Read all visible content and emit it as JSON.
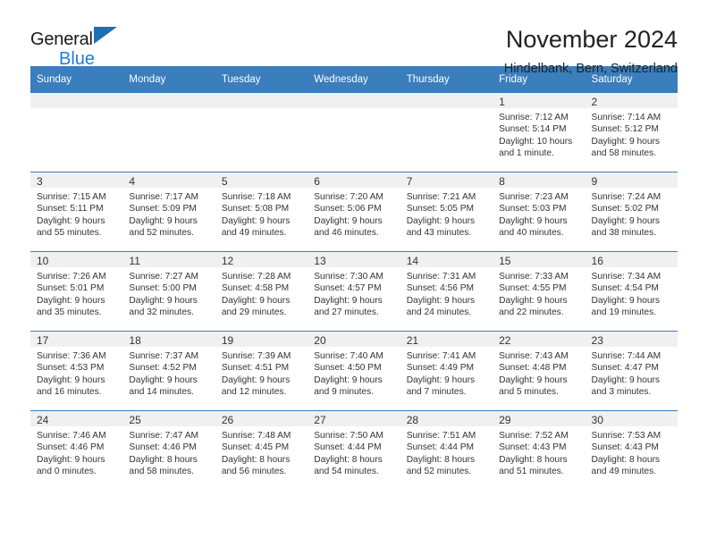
{
  "brand": {
    "line1": "General",
    "line2": "Blue",
    "triangle_color": "#1f6fb5",
    "blue_text_color": "#1f7fd0"
  },
  "header": {
    "title": "November 2024",
    "subtitle": "Hindelbank, Bern, Switzerland"
  },
  "theme": {
    "header_bar": "#3a7ebe",
    "daynum_band": "#f0f0f0",
    "cell_border": "#3a7ebe",
    "text": "#333333"
  },
  "calendar": {
    "weekday_headers": [
      "Sunday",
      "Monday",
      "Tuesday",
      "Wednesday",
      "Thursday",
      "Friday",
      "Saturday"
    ],
    "labels": {
      "sunrise": "Sunrise:",
      "sunset": "Sunset:",
      "daylight": "Daylight:"
    },
    "weeks": [
      [
        {
          "day": "",
          "empty": true,
          "sunrise": "",
          "sunset": "",
          "daylight_1": "",
          "daylight_2": ""
        },
        {
          "day": "",
          "empty": true,
          "sunrise": "",
          "sunset": "",
          "daylight_1": "",
          "daylight_2": ""
        },
        {
          "day": "",
          "empty": true,
          "sunrise": "",
          "sunset": "",
          "daylight_1": "",
          "daylight_2": ""
        },
        {
          "day": "",
          "empty": true,
          "sunrise": "",
          "sunset": "",
          "daylight_1": "",
          "daylight_2": ""
        },
        {
          "day": "",
          "empty": true,
          "sunrise": "",
          "sunset": "",
          "daylight_1": "",
          "daylight_2": ""
        },
        {
          "day": "1",
          "empty": false,
          "sunrise": "Sunrise: 7:12 AM",
          "sunset": "Sunset: 5:14 PM",
          "daylight_1": "Daylight: 10 hours",
          "daylight_2": "and 1 minute."
        },
        {
          "day": "2",
          "empty": false,
          "sunrise": "Sunrise: 7:14 AM",
          "sunset": "Sunset: 5:12 PM",
          "daylight_1": "Daylight: 9 hours",
          "daylight_2": "and 58 minutes."
        }
      ],
      [
        {
          "day": "3",
          "empty": false,
          "sunrise": "Sunrise: 7:15 AM",
          "sunset": "Sunset: 5:11 PM",
          "daylight_1": "Daylight: 9 hours",
          "daylight_2": "and 55 minutes."
        },
        {
          "day": "4",
          "empty": false,
          "sunrise": "Sunrise: 7:17 AM",
          "sunset": "Sunset: 5:09 PM",
          "daylight_1": "Daylight: 9 hours",
          "daylight_2": "and 52 minutes."
        },
        {
          "day": "5",
          "empty": false,
          "sunrise": "Sunrise: 7:18 AM",
          "sunset": "Sunset: 5:08 PM",
          "daylight_1": "Daylight: 9 hours",
          "daylight_2": "and 49 minutes."
        },
        {
          "day": "6",
          "empty": false,
          "sunrise": "Sunrise: 7:20 AM",
          "sunset": "Sunset: 5:06 PM",
          "daylight_1": "Daylight: 9 hours",
          "daylight_2": "and 46 minutes."
        },
        {
          "day": "7",
          "empty": false,
          "sunrise": "Sunrise: 7:21 AM",
          "sunset": "Sunset: 5:05 PM",
          "daylight_1": "Daylight: 9 hours",
          "daylight_2": "and 43 minutes."
        },
        {
          "day": "8",
          "empty": false,
          "sunrise": "Sunrise: 7:23 AM",
          "sunset": "Sunset: 5:03 PM",
          "daylight_1": "Daylight: 9 hours",
          "daylight_2": "and 40 minutes."
        },
        {
          "day": "9",
          "empty": false,
          "sunrise": "Sunrise: 7:24 AM",
          "sunset": "Sunset: 5:02 PM",
          "daylight_1": "Daylight: 9 hours",
          "daylight_2": "and 38 minutes."
        }
      ],
      [
        {
          "day": "10",
          "empty": false,
          "sunrise": "Sunrise: 7:26 AM",
          "sunset": "Sunset: 5:01 PM",
          "daylight_1": "Daylight: 9 hours",
          "daylight_2": "and 35 minutes."
        },
        {
          "day": "11",
          "empty": false,
          "sunrise": "Sunrise: 7:27 AM",
          "sunset": "Sunset: 5:00 PM",
          "daylight_1": "Daylight: 9 hours",
          "daylight_2": "and 32 minutes."
        },
        {
          "day": "12",
          "empty": false,
          "sunrise": "Sunrise: 7:28 AM",
          "sunset": "Sunset: 4:58 PM",
          "daylight_1": "Daylight: 9 hours",
          "daylight_2": "and 29 minutes."
        },
        {
          "day": "13",
          "empty": false,
          "sunrise": "Sunrise: 7:30 AM",
          "sunset": "Sunset: 4:57 PM",
          "daylight_1": "Daylight: 9 hours",
          "daylight_2": "and 27 minutes."
        },
        {
          "day": "14",
          "empty": false,
          "sunrise": "Sunrise: 7:31 AM",
          "sunset": "Sunset: 4:56 PM",
          "daylight_1": "Daylight: 9 hours",
          "daylight_2": "and 24 minutes."
        },
        {
          "day": "15",
          "empty": false,
          "sunrise": "Sunrise: 7:33 AM",
          "sunset": "Sunset: 4:55 PM",
          "daylight_1": "Daylight: 9 hours",
          "daylight_2": "and 22 minutes."
        },
        {
          "day": "16",
          "empty": false,
          "sunrise": "Sunrise: 7:34 AM",
          "sunset": "Sunset: 4:54 PM",
          "daylight_1": "Daylight: 9 hours",
          "daylight_2": "and 19 minutes."
        }
      ],
      [
        {
          "day": "17",
          "empty": false,
          "sunrise": "Sunrise: 7:36 AM",
          "sunset": "Sunset: 4:53 PM",
          "daylight_1": "Daylight: 9 hours",
          "daylight_2": "and 16 minutes."
        },
        {
          "day": "18",
          "empty": false,
          "sunrise": "Sunrise: 7:37 AM",
          "sunset": "Sunset: 4:52 PM",
          "daylight_1": "Daylight: 9 hours",
          "daylight_2": "and 14 minutes."
        },
        {
          "day": "19",
          "empty": false,
          "sunrise": "Sunrise: 7:39 AM",
          "sunset": "Sunset: 4:51 PM",
          "daylight_1": "Daylight: 9 hours",
          "daylight_2": "and 12 minutes."
        },
        {
          "day": "20",
          "empty": false,
          "sunrise": "Sunrise: 7:40 AM",
          "sunset": "Sunset: 4:50 PM",
          "daylight_1": "Daylight: 9 hours",
          "daylight_2": "and 9 minutes."
        },
        {
          "day": "21",
          "empty": false,
          "sunrise": "Sunrise: 7:41 AM",
          "sunset": "Sunset: 4:49 PM",
          "daylight_1": "Daylight: 9 hours",
          "daylight_2": "and 7 minutes."
        },
        {
          "day": "22",
          "empty": false,
          "sunrise": "Sunrise: 7:43 AM",
          "sunset": "Sunset: 4:48 PM",
          "daylight_1": "Daylight: 9 hours",
          "daylight_2": "and 5 minutes."
        },
        {
          "day": "23",
          "empty": false,
          "sunrise": "Sunrise: 7:44 AM",
          "sunset": "Sunset: 4:47 PM",
          "daylight_1": "Daylight: 9 hours",
          "daylight_2": "and 3 minutes."
        }
      ],
      [
        {
          "day": "24",
          "empty": false,
          "sunrise": "Sunrise: 7:46 AM",
          "sunset": "Sunset: 4:46 PM",
          "daylight_1": "Daylight: 9 hours",
          "daylight_2": "and 0 minutes."
        },
        {
          "day": "25",
          "empty": false,
          "sunrise": "Sunrise: 7:47 AM",
          "sunset": "Sunset: 4:46 PM",
          "daylight_1": "Daylight: 8 hours",
          "daylight_2": "and 58 minutes."
        },
        {
          "day": "26",
          "empty": false,
          "sunrise": "Sunrise: 7:48 AM",
          "sunset": "Sunset: 4:45 PM",
          "daylight_1": "Daylight: 8 hours",
          "daylight_2": "and 56 minutes."
        },
        {
          "day": "27",
          "empty": false,
          "sunrise": "Sunrise: 7:50 AM",
          "sunset": "Sunset: 4:44 PM",
          "daylight_1": "Daylight: 8 hours",
          "daylight_2": "and 54 minutes."
        },
        {
          "day": "28",
          "empty": false,
          "sunrise": "Sunrise: 7:51 AM",
          "sunset": "Sunset: 4:44 PM",
          "daylight_1": "Daylight: 8 hours",
          "daylight_2": "and 52 minutes."
        },
        {
          "day": "29",
          "empty": false,
          "sunrise": "Sunrise: 7:52 AM",
          "sunset": "Sunset: 4:43 PM",
          "daylight_1": "Daylight: 8 hours",
          "daylight_2": "and 51 minutes."
        },
        {
          "day": "30",
          "empty": false,
          "sunrise": "Sunrise: 7:53 AM",
          "sunset": "Sunset: 4:43 PM",
          "daylight_1": "Daylight: 8 hours",
          "daylight_2": "and 49 minutes."
        }
      ]
    ]
  }
}
